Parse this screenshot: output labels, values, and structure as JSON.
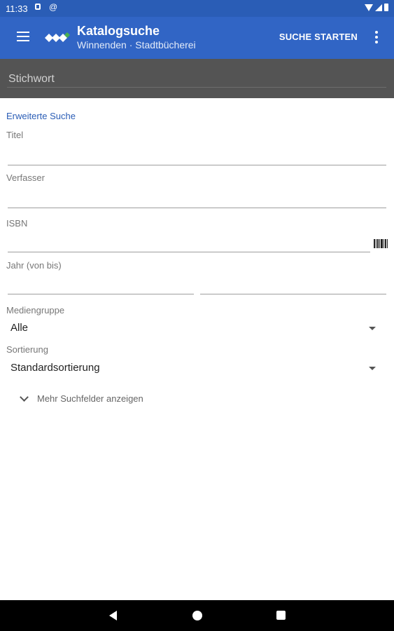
{
  "status_bar": {
    "time": "11:33",
    "icons": [
      "sd-card-icon",
      "at-sign-icon",
      "wifi-icon",
      "signal-icon",
      "battery-icon"
    ]
  },
  "app_bar": {
    "title": "Katalogsuche",
    "subtitle": "Winnenden · Stadtbücherei",
    "action_label": "SUCHE STARTEN",
    "icons": [
      "menu-icon",
      "app-logo",
      "overflow-menu-icon"
    ],
    "colors": {
      "bar": "#3165c5",
      "status": "#2a5db6",
      "logo_accent": "#4caf50"
    }
  },
  "keyword": {
    "placeholder": "Stichwort",
    "value": ""
  },
  "form": {
    "section_title": "Erweiterte Suche",
    "fields": {
      "title": {
        "label": "Titel",
        "value": ""
      },
      "author": {
        "label": "Verfasser",
        "value": ""
      },
      "isbn": {
        "label": "ISBN",
        "value": "",
        "icon": "barcode-icon"
      },
      "year": {
        "label": "Jahr (von bis)",
        "from": "",
        "to": ""
      }
    },
    "media_group": {
      "label": "Mediengruppe",
      "selected": "Alle"
    },
    "sorting": {
      "label": "Sortierung",
      "selected": "Standardsortierung"
    },
    "more_fields_label": "Mehr Suchfelder anzeigen"
  },
  "nav_bar": {
    "icons": [
      "back-icon",
      "home-icon",
      "recents-icon"
    ]
  }
}
